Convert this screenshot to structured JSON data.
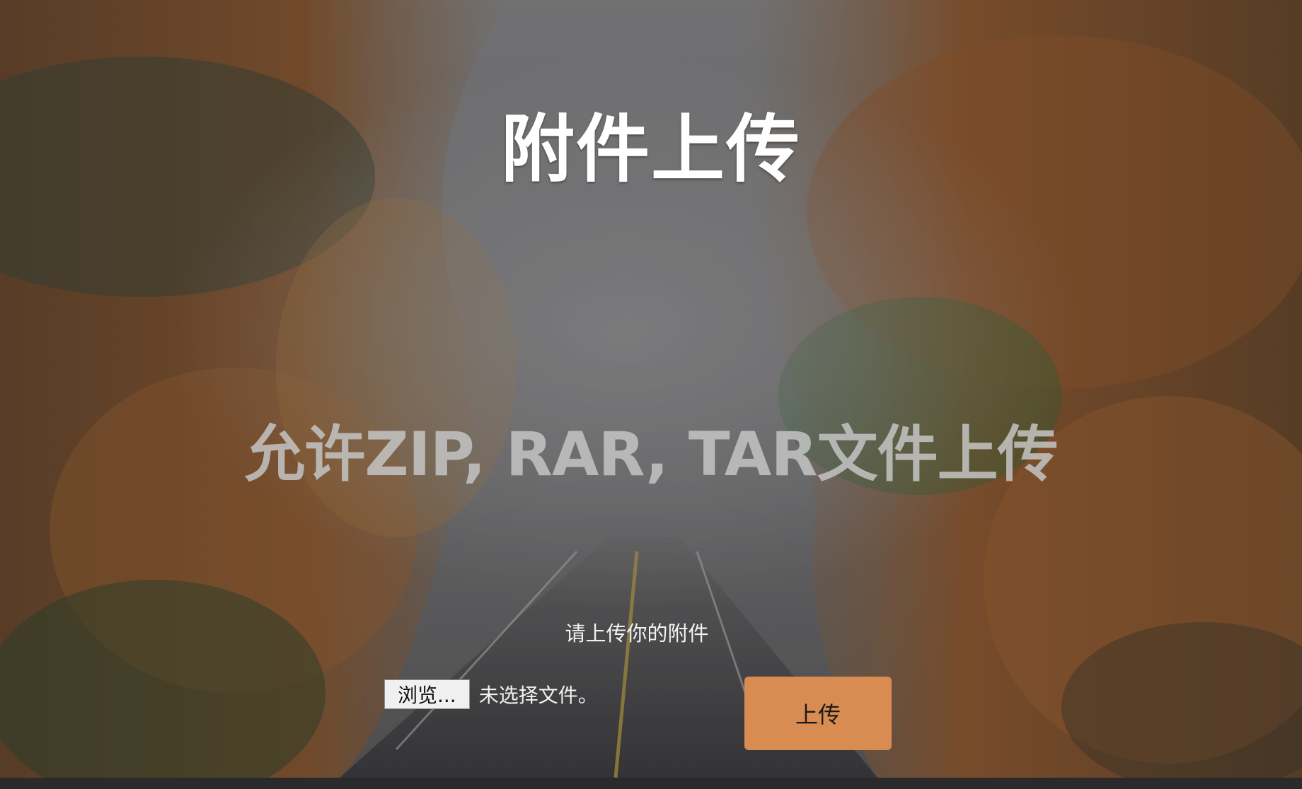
{
  "page": {
    "title": "附件上传",
    "subtitle": "允许ZIP, RAR, TAR文件上传",
    "prompt": "请上传你的附件"
  },
  "form": {
    "browse_label": "浏览...",
    "no_file_text": "未选择文件。",
    "upload_label": "上传"
  },
  "colors": {
    "upload_button": "#d88c52",
    "title": "#ffffff",
    "subtitle": "#c4c4c4"
  },
  "background": {
    "description_icon": "autumn-forest-road-image"
  }
}
